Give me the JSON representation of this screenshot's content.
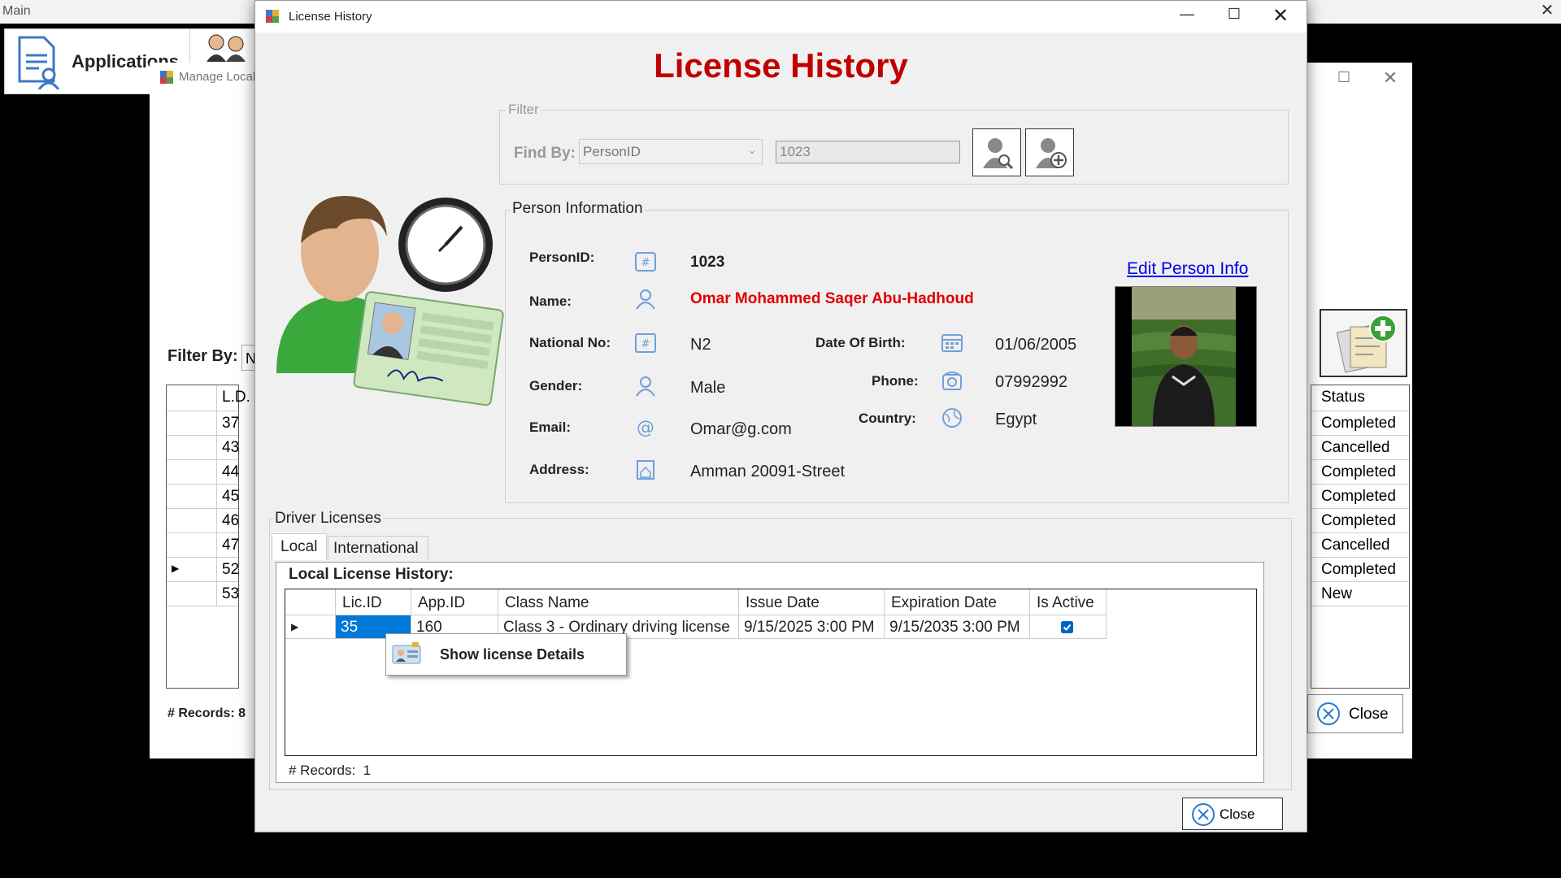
{
  "main": {
    "title": "Main"
  },
  "toolbar": {
    "applications_label": "Applications"
  },
  "manage": {
    "title": "Manage Local",
    "filter_label": "Filter By:",
    "filter_value": "N",
    "id_header": "L.D.",
    "ids": [
      "37",
      "43",
      "44",
      "45",
      "46",
      "47",
      "52",
      "53"
    ],
    "status_header": "Status",
    "statuses": [
      "Completed",
      "Cancelled",
      "Completed",
      "Completed",
      "Completed",
      "Cancelled",
      "Completed",
      "New"
    ],
    "records_label": "# Records: 8",
    "close_label": "Close"
  },
  "dialog": {
    "title": "License History",
    "heading": "License History",
    "filter": {
      "legend": "Filter",
      "find_by_label": "Find By:",
      "find_by_value": "PersonID",
      "search_value": "1023"
    },
    "person": {
      "legend": "Person Information",
      "labels": {
        "person_id": "PersonID:",
        "name": "Name:",
        "national_no": "National No:",
        "gender": "Gender:",
        "email": "Email:",
        "address": "Address:",
        "dob": "Date Of Birth:",
        "phone": "Phone:",
        "country": "Country:"
      },
      "values": {
        "person_id": "1023",
        "name": "Omar Mohammed Saqer Abu-Hadhoud",
        "national_no": "N2",
        "gender": "Male",
        "email": "Omar@g.com",
        "address": "Amman 20091-Street",
        "dob": "01/06/2005",
        "phone": "07992992",
        "country": "Egypt"
      },
      "edit_link": "Edit Person Info"
    },
    "drivers": {
      "legend": "Driver Licenses",
      "tabs": [
        "Local",
        "International"
      ],
      "local_heading": "Local License History:",
      "columns": [
        "Lic.ID",
        "App.ID",
        "Class Name",
        "Issue Date",
        "Expiration Date",
        "Is Active"
      ],
      "rows": [
        {
          "lic_id": "35",
          "app_id": "160",
          "class_name": "Class 3 - Ordinary driving license",
          "issue_date": "9/15/2025 3:00 PM",
          "expiration_date": "9/15/2035 3:00 PM",
          "is_active": true
        }
      ],
      "records_label": "# Records:",
      "records_count": "1"
    },
    "context_menu": {
      "item": "Show license Details"
    },
    "close_label": "Close"
  },
  "colors": {
    "heading_red": "#c00000",
    "name_red": "#e00000",
    "link_blue": "#0000ee",
    "selection_blue": "#0078d7"
  }
}
